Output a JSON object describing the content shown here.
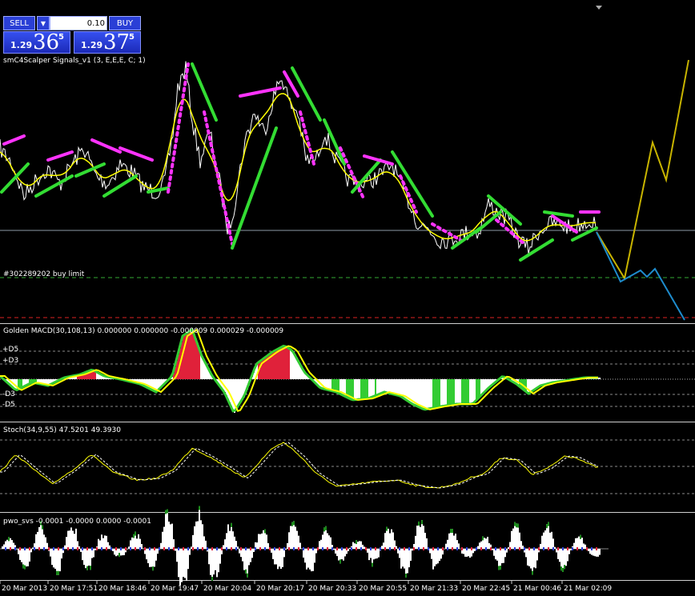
{
  "trade_panel": {
    "sell_label": "SELL",
    "buy_label": "BUY",
    "lot_value": "0.10",
    "sell_price": {
      "prefix": "1.29",
      "main": "36",
      "sup": "5"
    },
    "buy_price": {
      "prefix": "1.29",
      "main": "37",
      "sup": "5"
    }
  },
  "indicators": {
    "main": "smC4Scalper Signals_v1 (3, E,E,E, C; 1)",
    "order": "#302289202 buy limit",
    "macd": "Golden MACD(30,108,13) 0.000000 0.000000 -0.000009 0.000029 -0.000009",
    "stoch": "Stoch(34,9,55) 47.5201 49.3930",
    "pwo": "pwo_svs -0.0001 -0.0000 0.0000 -0.0001"
  },
  "macd_levels": [
    "+D5",
    "+D3",
    "-D3",
    "-D5"
  ],
  "time_axis": [
    "20 Mar 2013",
    "20 Mar 17:51",
    "20 Mar 18:46",
    "20 Mar 19:47",
    "20 Mar 20:04",
    "20 Mar 20:17",
    "20 Mar 20:33",
    "20 Mar 20:55",
    "20 Mar 21:33",
    "20 Mar 22:45",
    "21 Mar 00:46",
    "21 Mar 02:09"
  ],
  "colors": {
    "price": "#ffffff",
    "ma": "#ffff00",
    "channel_up": "#33dd33",
    "channel_down": "#ff33ff",
    "forecast_up": "#c8b400",
    "forecast_down": "#1e8ccd",
    "macd_red": "#e0213a",
    "macd_green": "#33cc33",
    "grid": "#888888"
  }
}
